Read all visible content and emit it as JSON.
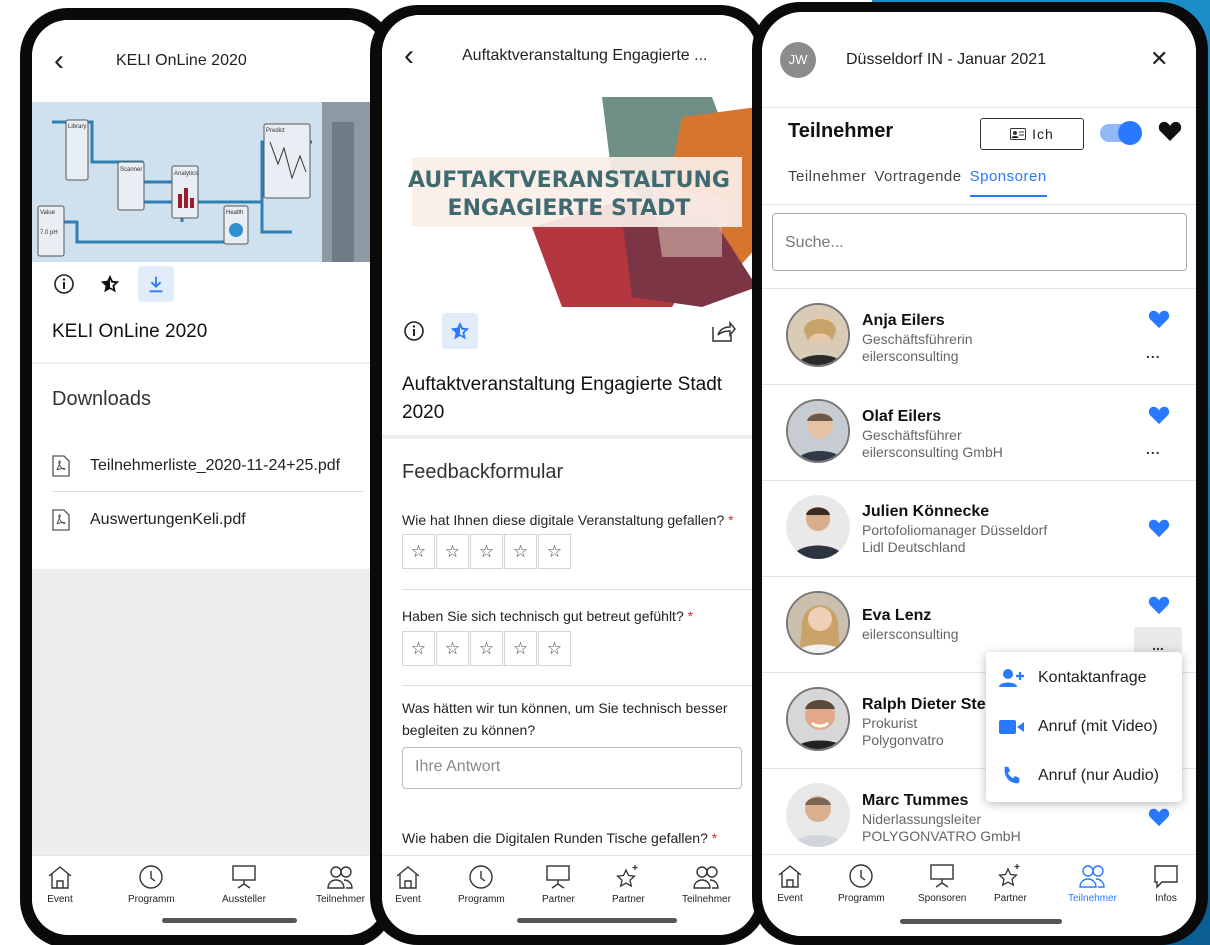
{
  "colors": {
    "accent": "#2979ff",
    "required": "#d32f2f",
    "blue_bg": "#0d6fa8"
  },
  "phone1": {
    "header_title": "KELI OnLine 2020",
    "banner_labels": [
      "Library",
      "Scanner",
      "Analytics",
      "Predict",
      "Health",
      "Value",
      "7.0 pH"
    ],
    "event_title": "KELI OnLine 2020",
    "section_title": "Downloads",
    "downloads": [
      {
        "name": "Teilnehmerliste_2020-11-24+25.pdf"
      },
      {
        "name": "AuswertungenKeli.pdf"
      }
    ],
    "tabs": [
      "Event",
      "Programm",
      "Aussteller",
      "Teilnehmer"
    ]
  },
  "phone2": {
    "header_title": "Auftaktveranstaltung Engagierte ...",
    "banner_line1": "AUFTAKTVERANSTALTUNG",
    "banner_line2": "ENGAGIERTE STADT",
    "event_title": "Auftaktveranstaltung Engagierte Stadt 2020",
    "form_title": "Feedbackformular",
    "questions": [
      {
        "text": "Wie hat Ihnen diese digitale Veranstaltung gefallen?",
        "required_mark": "*"
      },
      {
        "text": "Haben Sie sich technisch gut betreut gefühlt?",
        "required_mark": "*"
      },
      {
        "text": "Was hätten wir tun können, um Sie technisch besser begleiten zu können?",
        "placeholder": "Ihre Antwort"
      },
      {
        "text": "Wie haben die Digitalen Runden Tische gefallen?",
        "required_mark": "*"
      }
    ],
    "star_glyph": "☆",
    "tabs": [
      "Event",
      "Programm",
      "Partner",
      "Partner",
      "Teilnehmer"
    ]
  },
  "phone3": {
    "avatar_initials": "JW",
    "header_title": "Düsseldorf IN - Januar 2021",
    "close_glyph": "✕",
    "page_title": "Teilnehmer",
    "ich_label": "Ich",
    "filter_tabs": [
      "Teilnehmer",
      "Vortragende",
      "Sponsoren"
    ],
    "search_placeholder": "Suche...",
    "people": [
      {
        "name": "Anja Eilers",
        "line1": "Geschäftsführerin",
        "line2": "eilersconsulting"
      },
      {
        "name": "Olaf Eilers",
        "line1": "Geschäftsführer",
        "line2": "eilersconsulting GmbH"
      },
      {
        "name": "Julien Könnecke",
        "line1": "Portofoliomanager Düsseldorf",
        "line2": "Lidl Deutschland"
      },
      {
        "name": "Eva Lenz",
        "line1": "eilersconsulting",
        "line2": ""
      },
      {
        "name": "Ralph Dieter Stei",
        "line1": "Prokurist",
        "line2": "Polygonvatro"
      },
      {
        "name": "Marc Tummes",
        "line1": "Niderlassungsleiter",
        "line2": "POLYGONVATRO GmbH"
      }
    ],
    "more_label": "...",
    "menu": [
      "Kontaktanfrage",
      "Anruf (mit Video)",
      "Anruf (nur Audio)"
    ],
    "tabs": [
      "Event",
      "Programm",
      "Sponsoren",
      "Partner",
      "Teilnehmer",
      "Infos"
    ]
  }
}
